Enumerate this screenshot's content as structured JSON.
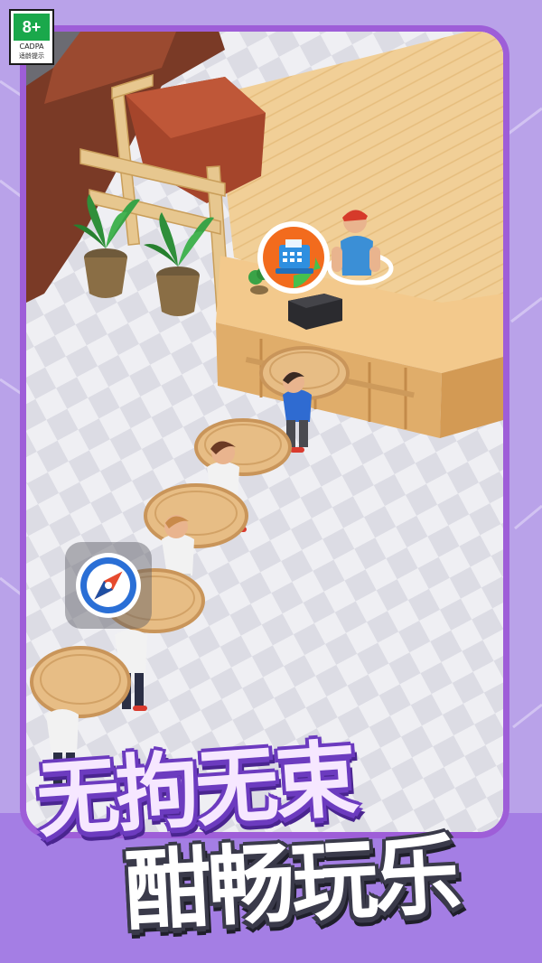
{
  "age_rating": {
    "rating": "8+",
    "organization": "CADPA",
    "hint": "适龄提示"
  },
  "headline": {
    "line1": "无拘无束",
    "line2": "酣畅玩乐"
  },
  "game": {
    "register_icon": "cash-register-icon",
    "compass_icon": "compass-icon"
  },
  "colors": {
    "frame": "#9e5ed8",
    "background": "#b9a2e9",
    "headline_outline": "#6c3bbf",
    "register_badge": "#f26b1d"
  }
}
